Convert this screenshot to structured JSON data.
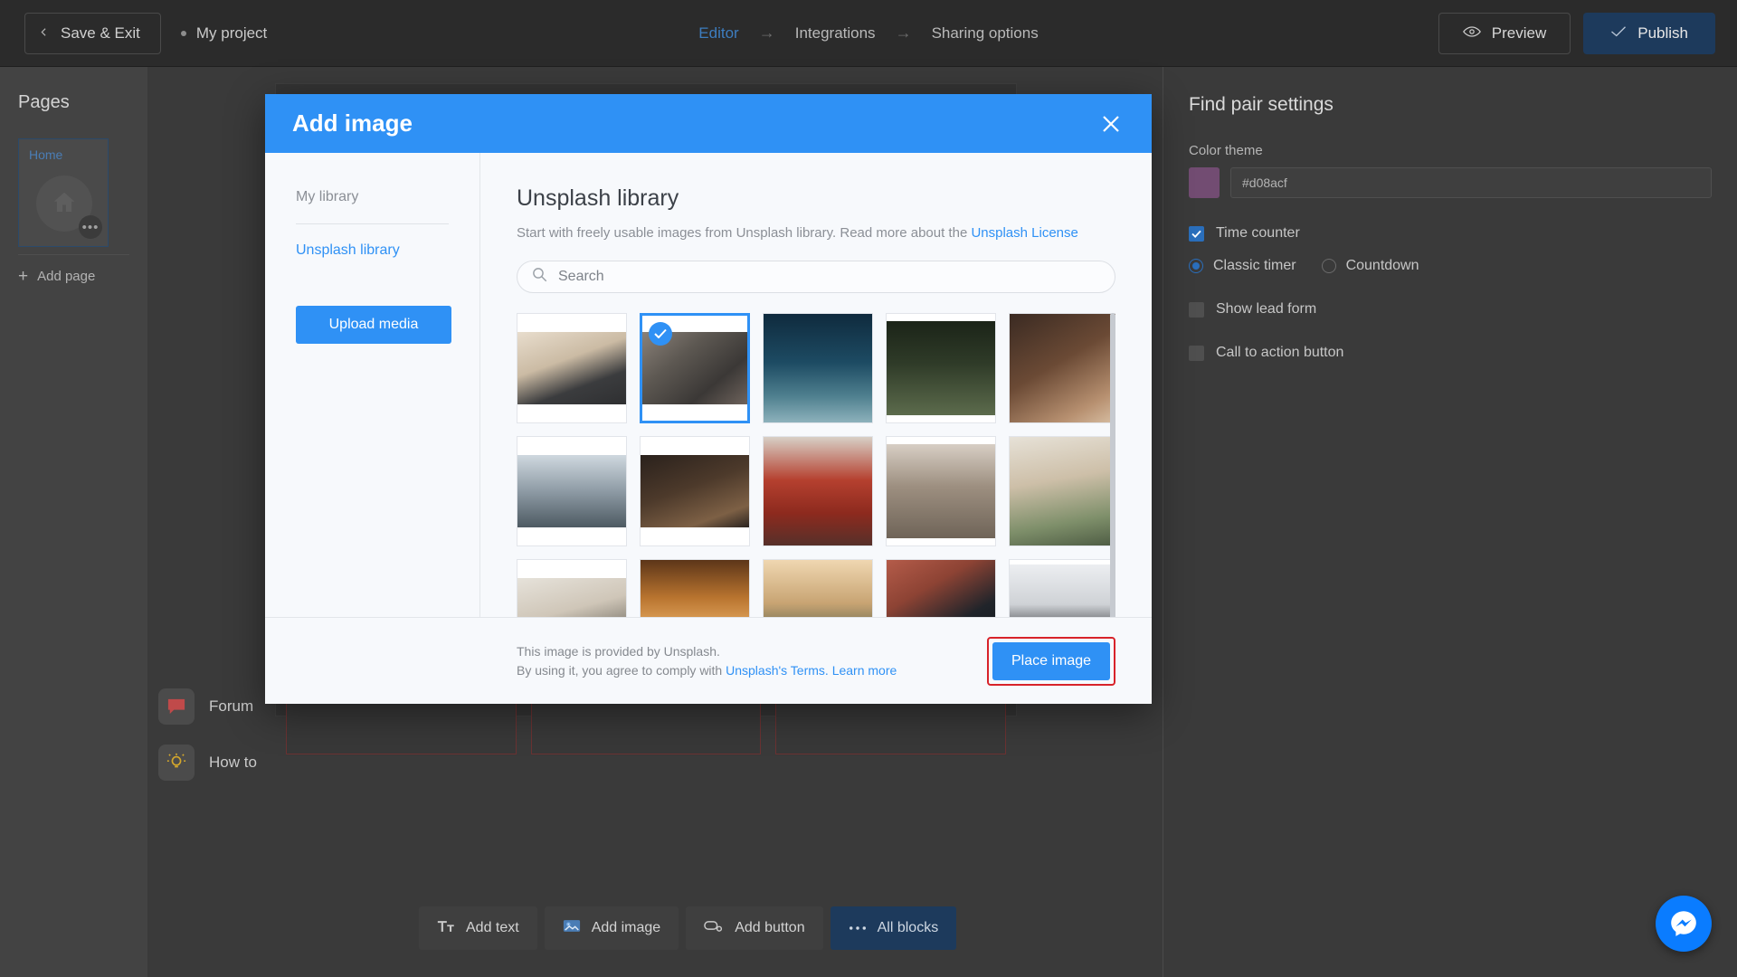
{
  "topbar": {
    "save_exit_label": "Save & Exit",
    "project_name": "My project",
    "breadcrumbs": [
      {
        "label": "Editor",
        "active": true
      },
      {
        "label": "Integrations",
        "active": false
      },
      {
        "label": "Sharing options",
        "active": false
      }
    ],
    "arrow_glyph": "→",
    "preview_label": "Preview",
    "publish_label": "Publish"
  },
  "sidebar": {
    "title": "Pages",
    "page_card": {
      "label": "Home",
      "more_label": "•••"
    },
    "add_page_label": "Add page"
  },
  "help": {
    "items": [
      {
        "label": "Forum",
        "icon": "chat-icon"
      },
      {
        "label": "How to",
        "icon": "lightbulb-icon"
      }
    ]
  },
  "blocks_toolbar": {
    "items": [
      {
        "label": "Add text",
        "icon": "text-icon",
        "primary": false
      },
      {
        "label": "Add image",
        "icon": "image-icon",
        "primary": false
      },
      {
        "label": "Add button",
        "icon": "button-icon",
        "primary": false
      },
      {
        "label": "All blocks",
        "icon": "ellipsis-icon",
        "primary": true
      }
    ]
  },
  "right_panel": {
    "title": "Find pair settings",
    "color_theme_label": "Color theme",
    "color_theme_value": "#d08acf",
    "color_swatch_hex": "#d08acf",
    "options": [
      {
        "label": "Time counter",
        "type": "checkbox",
        "checked": true
      },
      {
        "label": "Show lead form",
        "type": "checkbox",
        "checked": false
      },
      {
        "label": "Call to action button",
        "type": "checkbox",
        "checked": false
      }
    ],
    "timer_modes": [
      {
        "label": "Classic timer",
        "selected": true
      },
      {
        "label": "Countdown",
        "selected": false
      }
    ]
  },
  "modal": {
    "title": "Add image",
    "close_icon": "close-icon",
    "nav": {
      "my_library": "My library",
      "unsplash_library": "Unsplash library",
      "upload_button": "Upload media"
    },
    "library": {
      "heading": "Unsplash library",
      "description_prefix": "Start with freely usable images from Unsplash library. Read more about the ",
      "license_link": "Unsplash License",
      "search_placeholder": "Search",
      "search_value": "",
      "search_icon": "search-icon"
    },
    "thumbnails": [
      {
        "name": "laptop-desk-notebook",
        "selected": false,
        "tone": "g1"
      },
      {
        "name": "aerial-city-buildings",
        "selected": true,
        "tone": "g2"
      },
      {
        "name": "ocean-cliff-coast",
        "selected": false,
        "tone": "g3"
      },
      {
        "name": "person-walking-forest",
        "selected": false,
        "tone": "g4"
      },
      {
        "name": "pottery-hands-wheel",
        "selected": false,
        "tone": "g5"
      },
      {
        "name": "sunroom-window-seat",
        "selected": false,
        "tone": "g6"
      },
      {
        "name": "attic-library-books",
        "selected": false,
        "tone": "g7"
      },
      {
        "name": "red-pagoda-temple",
        "selected": false,
        "tone": "g8"
      },
      {
        "name": "small-bird-branch",
        "selected": false,
        "tone": "g9"
      },
      {
        "name": "potted-plant-stand",
        "selected": false,
        "tone": "g10"
      },
      {
        "name": "artist-studio-canvas",
        "selected": false,
        "tone": "g11"
      },
      {
        "name": "narrow-orange-stairway",
        "selected": false,
        "tone": "g12"
      },
      {
        "name": "misty-river-canyon",
        "selected": false,
        "tone": "g13"
      },
      {
        "name": "woman-red-beanie-wall",
        "selected": false,
        "tone": "g14"
      },
      {
        "name": "two-women-laptop-bed",
        "selected": false,
        "tone": "g15"
      }
    ],
    "footer": {
      "line1": "This image is provided by Unsplash.",
      "line2_prefix": "By using it, you agree to comply with ",
      "terms_link": "Unsplash's Terms.",
      "learn_more_link": "Learn more",
      "place_button": "Place image",
      "place_button_highlight": "#d8232a"
    }
  },
  "fab": {
    "name": "messenger-fab",
    "color": "#0a7cff"
  }
}
